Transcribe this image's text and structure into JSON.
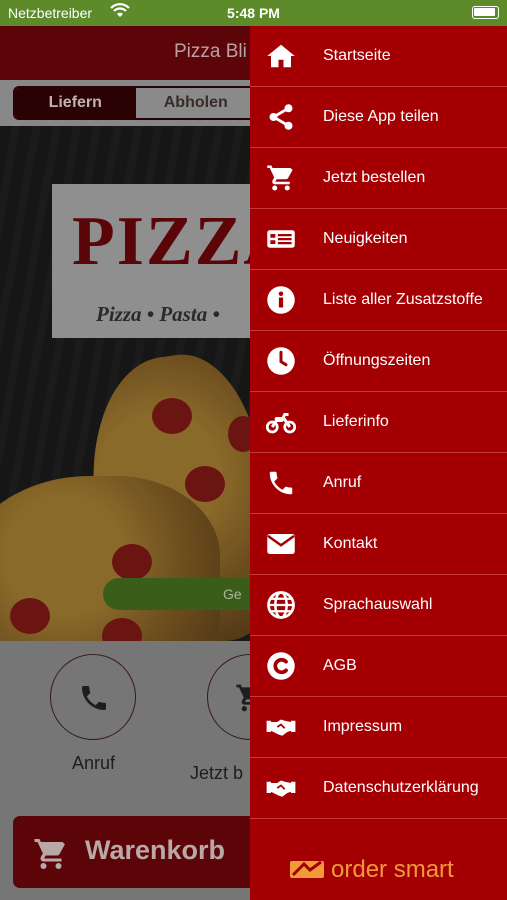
{
  "status_bar": {
    "carrier": "Netzbetreiber",
    "time": "5:48 PM"
  },
  "app": {
    "title": "Pizza Bli",
    "toggle": {
      "deliver": "Liefern",
      "pickup": "Abholen"
    },
    "logo": {
      "title": "PIZZA",
      "subtitle": "Pizza • Pasta •"
    },
    "pill_text": "Ge",
    "quick_actions": [
      {
        "label": "Anruf",
        "icon": "phone-icon"
      },
      {
        "label": "Jetzt b",
        "icon": "cart-icon"
      }
    ],
    "cart_button": "Warenkorb"
  },
  "drawer": {
    "items": [
      {
        "label": "Startseite",
        "icon": "home-icon"
      },
      {
        "label": "Diese App teilen",
        "icon": "share-icon"
      },
      {
        "label": "Jetzt bestellen",
        "icon": "cart-icon"
      },
      {
        "label": "Neuigkeiten",
        "icon": "news-icon"
      },
      {
        "label": "Liste aller Zusatzstoffe",
        "icon": "info-icon"
      },
      {
        "label": "Öffnungszeiten",
        "icon": "clock-icon"
      },
      {
        "label": "Lieferinfo",
        "icon": "motorcycle-icon"
      },
      {
        "label": "Anruf",
        "icon": "phone-icon"
      },
      {
        "label": "Kontakt",
        "icon": "envelope-icon"
      },
      {
        "label": "Sprachauswahl",
        "icon": "globe-icon"
      },
      {
        "label": "AGB",
        "icon": "copyright-icon"
      },
      {
        "label": "Impressum",
        "icon": "handshake-icon"
      },
      {
        "label": "Datenschutzerklärung",
        "icon": "handshake-icon"
      }
    ],
    "brand": "order smart"
  },
  "colors": {
    "drawer_bg": "#a40004",
    "status_bar": "#5d8b2a",
    "brand_orange": "#f19a3a"
  }
}
